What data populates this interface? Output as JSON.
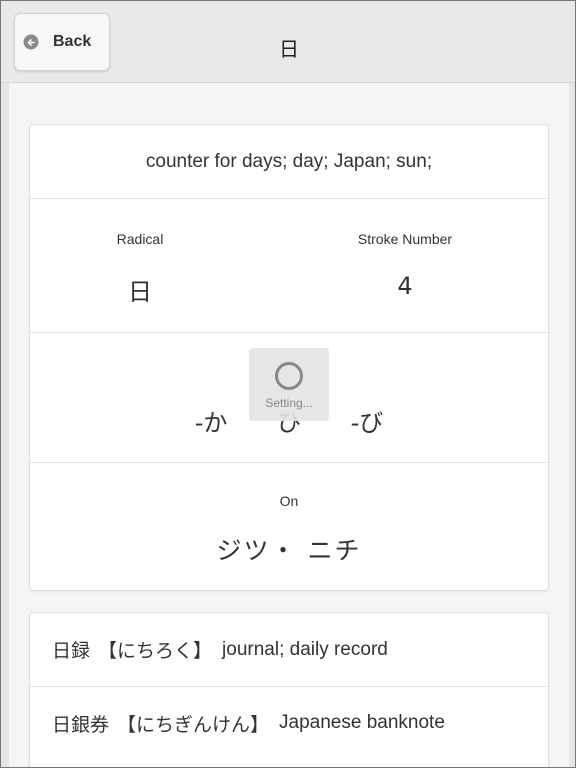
{
  "header": {
    "back_label": "Back",
    "title": "日"
  },
  "kanji": {
    "meaning": "counter for days; day; Japan; sun;",
    "radical_label": "Radical",
    "radical_value": "日",
    "stroke_label": "Stroke Number",
    "stroke_value": "4",
    "kun_readings": [
      "-か",
      "ひ",
      "-び"
    ],
    "on_label": "On",
    "on_value": "ジツ・ ニチ"
  },
  "loading": {
    "text": "Setting..."
  },
  "compounds": [
    {
      "word": "日録",
      "reading": "【にちろく】",
      "gloss": "journal; daily record"
    },
    {
      "word": "日銀券",
      "reading": "【にちぎんけん】",
      "gloss": "Japanese banknote"
    }
  ],
  "colors": {
    "header_bg": "#e9e9e9",
    "content_bg": "#f5f5f5",
    "card_bg": "#ffffff",
    "text": "#333333"
  }
}
